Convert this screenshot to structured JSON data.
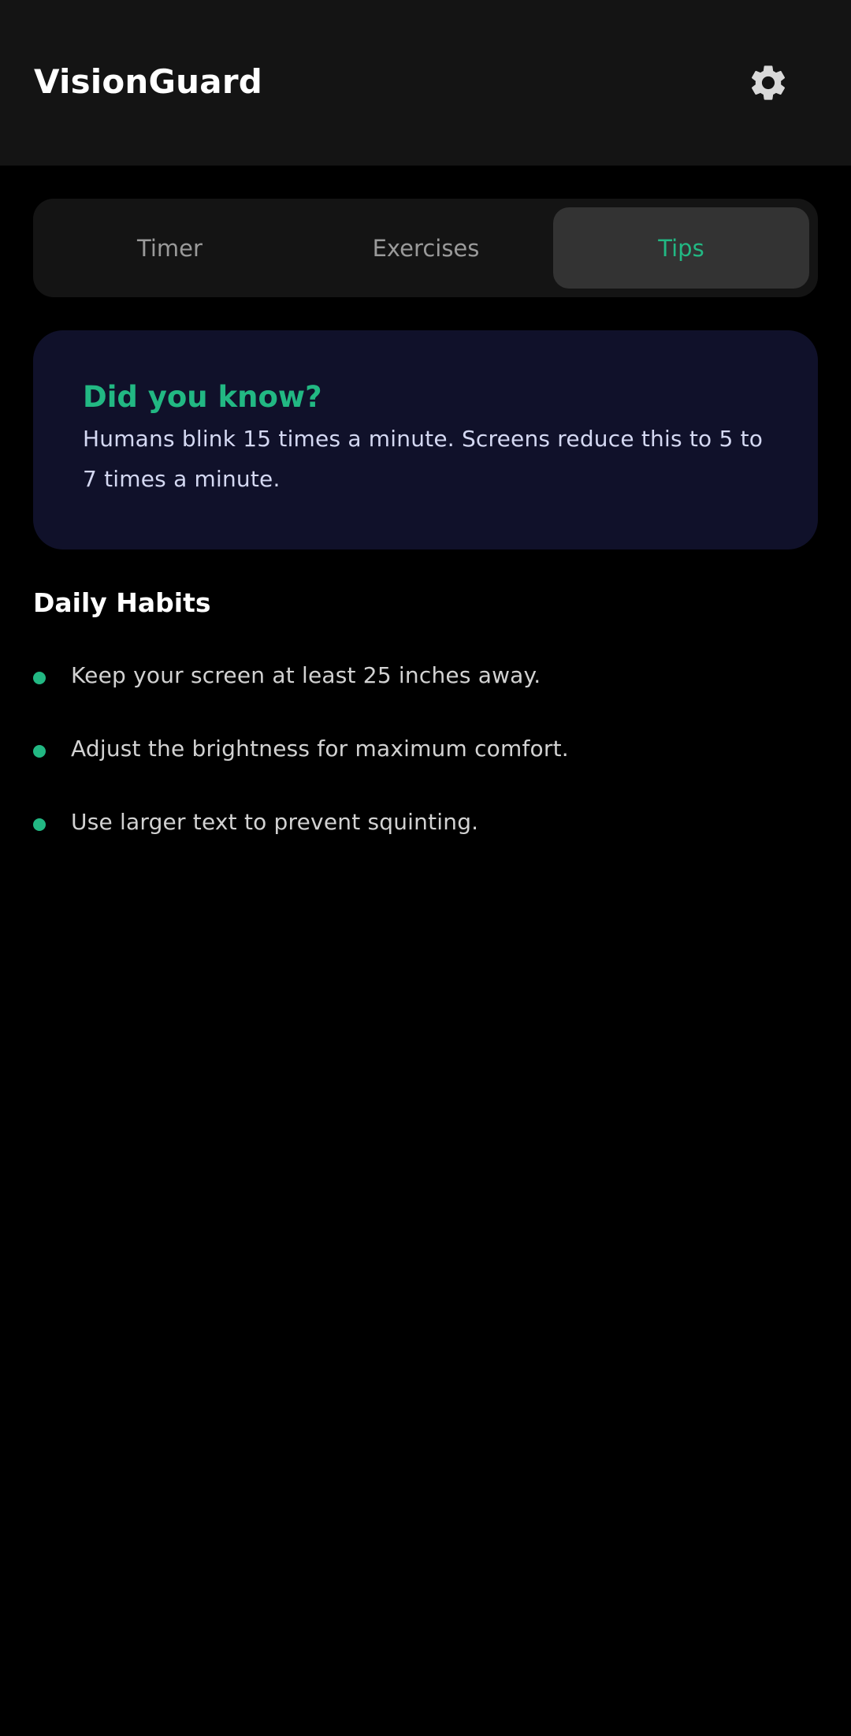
{
  "app": {
    "title": "VisionGuard",
    "settings_icon": "gear-icon"
  },
  "tabs": [
    {
      "label": "Timer",
      "active": false
    },
    {
      "label": "Exercises",
      "active": false
    },
    {
      "label": "Tips",
      "active": true
    }
  ],
  "info_card": {
    "title": "Did you know?",
    "body": "Humans blink 15 times a minute. Screens reduce this to 5 to 7 times a minute."
  },
  "daily_habits": {
    "title": "Daily Habits",
    "items": [
      "Keep your screen at least 25 inches away.",
      "Adjust the brightness for maximum comfort.",
      "Use larger text to prevent squinting."
    ]
  },
  "colors": {
    "background": "#000000",
    "app_bar": "#141414",
    "accent": "#22b883",
    "card": "#10112a",
    "active_tab": "#333333"
  }
}
